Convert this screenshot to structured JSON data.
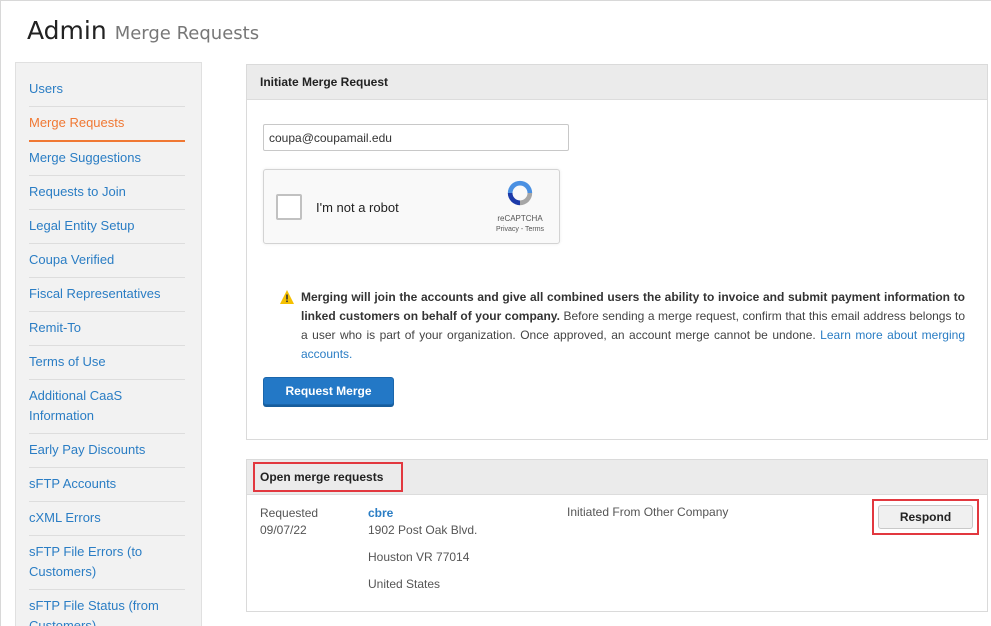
{
  "header": {
    "title": "Admin",
    "subtitle": "Merge Requests"
  },
  "sidebar": {
    "items": [
      {
        "label": "Users",
        "active": false
      },
      {
        "label": "Merge Requests",
        "active": true
      },
      {
        "label": "Merge Suggestions",
        "active": false
      },
      {
        "label": "Requests to Join",
        "active": false
      },
      {
        "label": "Legal Entity Setup",
        "active": false
      },
      {
        "label": "Coupa Verified",
        "active": false
      },
      {
        "label": "Fiscal Representatives",
        "active": false
      },
      {
        "label": "Remit-To",
        "active": false
      },
      {
        "label": "Terms of Use",
        "active": false
      },
      {
        "label": "Additional CaaS Information",
        "active": false
      },
      {
        "label": "Early Pay Discounts",
        "active": false
      },
      {
        "label": "sFTP Accounts",
        "active": false
      },
      {
        "label": "cXML Errors",
        "active": false
      },
      {
        "label": "sFTP File Errors (to Customers)",
        "active": false
      },
      {
        "label": "sFTP File Status (from Customers)",
        "active": false
      }
    ]
  },
  "initiate": {
    "heading": "Initiate Merge Request",
    "email_value": "coupa@coupamail.edu",
    "recaptcha": {
      "label": "I'm not a robot",
      "brand": "reCAPTCHA",
      "links": "Privacy - Terms"
    },
    "notice": {
      "bold": "Merging will join the accounts and give all combined users the ability to invoice and submit payment information to linked customers on behalf of your company.",
      "body": " Before sending a merge request, confirm that this email address belongs to a user who is part of your organization. Once approved, an account merge cannot be undone. ",
      "link": "Learn more about merging accounts."
    },
    "button_label": "Request Merge"
  },
  "open_requests": {
    "heading": "Open merge requests",
    "rows": [
      {
        "status": "Requested",
        "date": "09/07/22",
        "company": "cbre",
        "address_line1": "1902 Post Oak Blvd.",
        "address_line2": "Houston VR 77014",
        "address_line3": "United States",
        "initiated": "Initiated From Other Company",
        "action_label": "Respond"
      }
    ]
  },
  "colors": {
    "accent_orange": "#f07833",
    "link_blue": "#2a7dc4",
    "primary_button": "#2378c6",
    "highlight_red": "#e2383f"
  }
}
